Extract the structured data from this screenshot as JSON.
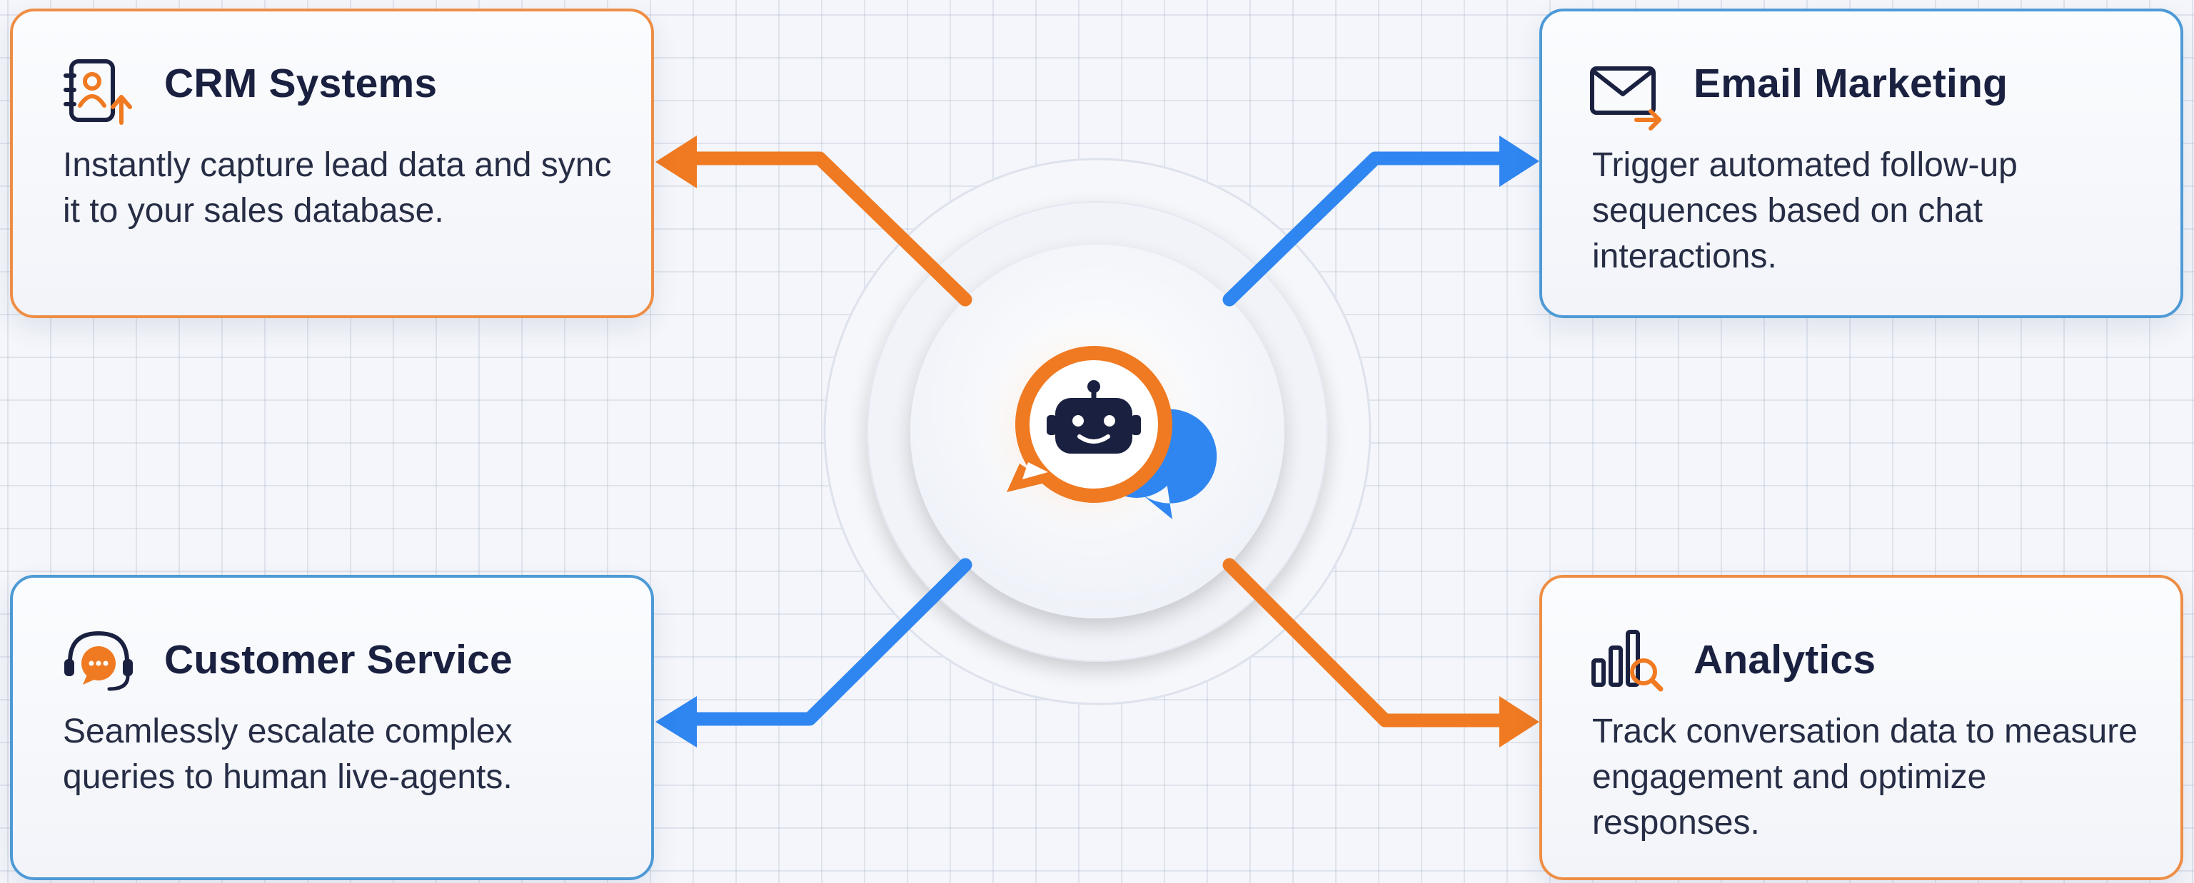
{
  "colors": {
    "orange": "#f07a22",
    "blue": "#2f86f0",
    "navy": "#1a2140"
  },
  "hub": {
    "icon": "chatbot-icon"
  },
  "cards": {
    "crm": {
      "icon": "crm-contact-icon",
      "title": "CRM Systems",
      "description": "Instantly capture lead data and sync it to your sales database."
    },
    "email": {
      "icon": "email-icon",
      "title": "Email Marketing",
      "description": "Trigger automated follow-up sequences based on chat interactions."
    },
    "service": {
      "icon": "headset-chat-icon",
      "title": "Customer Service",
      "description": "Seamlessly escalate complex queries to human live-agents."
    },
    "analytics": {
      "icon": "analytics-chart-icon",
      "title": "Analytics",
      "description": "Track conversation data to measure engagement and optimize responses."
    }
  }
}
